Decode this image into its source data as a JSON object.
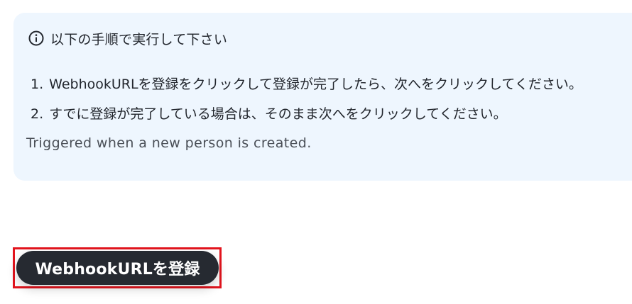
{
  "instructions": {
    "heading": "以下の手順で実行して下さい",
    "steps": [
      {
        "number": "1.",
        "text": "WebhookURLを登録をクリックして登録が完了したら、次へをクリックしてください。"
      },
      {
        "number": "2.",
        "text": "すでに登録が完了している場合は、そのまま次へをクリックしてください。"
      }
    ],
    "note": "Triggered when a new person is created."
  },
  "actions": {
    "register_webhook_label": "WebhookURLを登録"
  },
  "colors": {
    "panel_background": "#eef6fe",
    "button_background": "#262a31",
    "highlight_border": "#e3141d"
  },
  "icons": {
    "heading_icon": "info-circle-icon"
  }
}
